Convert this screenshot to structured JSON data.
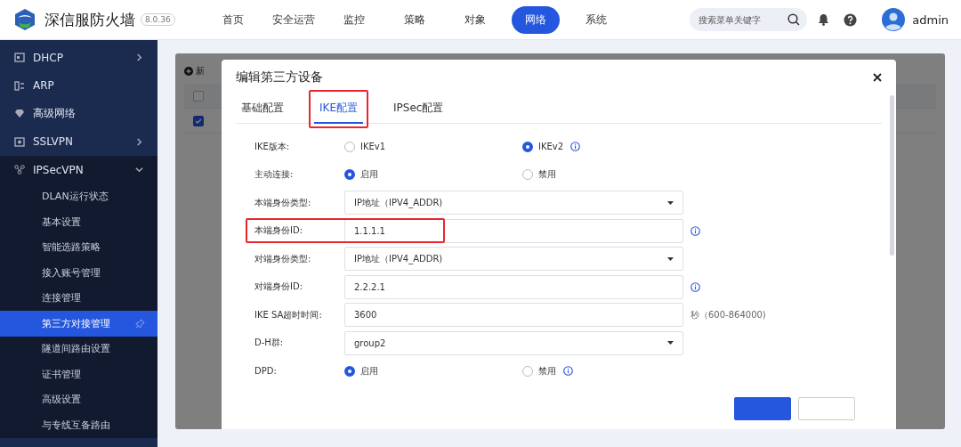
{
  "header": {
    "brand": "深信服防火墙",
    "version": "8.0.36",
    "search": {
      "placeholder": "搜索菜单关键字"
    },
    "user": "admin",
    "nav": [
      {
        "label": "首页",
        "selected": false
      },
      {
        "label": "安全运营",
        "selected": false
      },
      {
        "label": "监控",
        "selected": false
      },
      {
        "label": "策略",
        "selected": false
      },
      {
        "label": "对象",
        "selected": false
      },
      {
        "label": "网络",
        "selected": true
      },
      {
        "label": "系统",
        "selected": false
      }
    ]
  },
  "sidebar": {
    "items": [
      {
        "label": "DHCP",
        "kind": "folder",
        "expanded": false
      },
      {
        "label": "ARP",
        "kind": "page"
      },
      {
        "label": "高级网络",
        "kind": "page"
      },
      {
        "label": "SSLVPN",
        "kind": "folder",
        "expanded": false
      },
      {
        "label": "IPSecVPN",
        "kind": "folder",
        "expanded": true,
        "children": [
          {
            "label": "DLAN运行状态",
            "selected": false
          },
          {
            "label": "基本设置",
            "selected": false
          },
          {
            "label": "智能选路策略",
            "selected": false
          },
          {
            "label": "接入账号管理",
            "selected": false
          },
          {
            "label": "连接管理",
            "selected": false
          },
          {
            "label": "第三方对接管理",
            "selected": true
          },
          {
            "label": "隧道间路由设置",
            "selected": false
          },
          {
            "label": "证书管理",
            "selected": false
          },
          {
            "label": "高级设置",
            "selected": false
          },
          {
            "label": "与专线互备路由",
            "selected": false
          }
        ]
      }
    ]
  },
  "background_table": {
    "add_button": "新",
    "header_checked": false,
    "rows": [
      {
        "checked": true
      }
    ]
  },
  "dialog": {
    "title": "编辑第三方设备",
    "tabs": [
      {
        "label": "基础配置",
        "selected": false,
        "highlighted": false
      },
      {
        "label": "IKE配置",
        "selected": true,
        "highlighted": true
      },
      {
        "label": "IPSec配置",
        "selected": false,
        "highlighted": false
      }
    ],
    "rows": [
      {
        "label": "IKE版本:",
        "kind": "radio",
        "info": true,
        "highlighted": false,
        "options": [
          {
            "label": "IKEv1",
            "selected": false
          },
          {
            "label": "IKEv2",
            "selected": true
          }
        ]
      },
      {
        "label": "主动连接:",
        "kind": "radio",
        "info": false,
        "highlighted": false,
        "options": [
          {
            "label": "启用",
            "selected": true
          },
          {
            "label": "禁用",
            "selected": false
          }
        ]
      },
      {
        "label": "本端身份类型:",
        "kind": "select",
        "info": false,
        "highlighted": false,
        "value": "IP地址（IPV4_ADDR)"
      },
      {
        "label": "本端身份ID:",
        "kind": "input",
        "info": true,
        "highlighted": true,
        "value": "1.1.1.1"
      },
      {
        "label": "对端身份类型:",
        "kind": "select",
        "info": false,
        "highlighted": false,
        "value": "IP地址（IPV4_ADDR)"
      },
      {
        "label": "对端身份ID:",
        "kind": "input",
        "info": true,
        "highlighted": false,
        "value": "2.2.2.1"
      },
      {
        "label": "IKE SA超时时间:",
        "kind": "input",
        "info": false,
        "highlighted": false,
        "value": "3600",
        "suffix": "秒（600-864000)"
      },
      {
        "label": "D-H群:",
        "kind": "select",
        "info": false,
        "highlighted": false,
        "value": "group2"
      },
      {
        "label": "DPD:",
        "kind": "radio",
        "info": true,
        "highlighted": false,
        "options": [
          {
            "label": "启用",
            "selected": true
          },
          {
            "label": "禁用",
            "selected": false
          }
        ]
      }
    ],
    "footer_buttons": [
      {
        "kind": "primary"
      },
      {
        "kind": "default"
      }
    ]
  }
}
